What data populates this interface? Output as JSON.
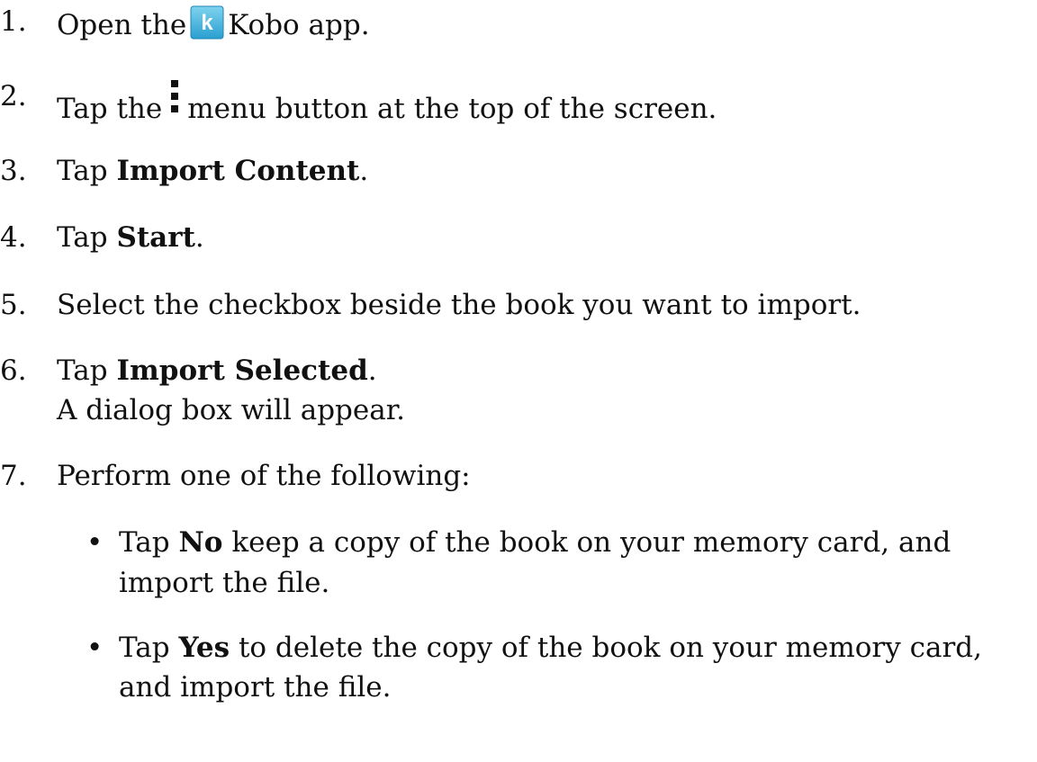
{
  "steps": [
    {
      "number": "1.",
      "before": "Open the",
      "icon": "kobo-app-icon",
      "icon_letter": "k",
      "after": "Kobo app."
    },
    {
      "number": "2.",
      "before": "Tap the",
      "icon": "vertical-ellipsis-menu-icon",
      "after": "menu button at the top of the screen."
    },
    {
      "number": "3.",
      "before": "Tap",
      "bold": "Import Content",
      "after": "."
    },
    {
      "number": "4.",
      "before": "Tap",
      "bold": "Start",
      "after": "."
    },
    {
      "number": "5.",
      "text": "Select the checkbox beside the book you want to import."
    },
    {
      "number": "6.",
      "before": "Tap",
      "bold": "Import Selected",
      "after": ".",
      "note": "A dialog box will appear."
    },
    {
      "number": "7.",
      "text": "Perform one of the following:"
    }
  ],
  "options": [
    {
      "bullet": "•",
      "before": "Tap",
      "bold": "No",
      "line1_after": "keep a copy of the book on your memory card, and",
      "line2": "import the file."
    },
    {
      "bullet": "•",
      "before": "Tap",
      "bold": "Yes",
      "line1_after": "to delete the copy of the book on your memory card,",
      "line2": "and import the file."
    }
  ],
  "colors": {
    "text": "#111111",
    "kobo_icon_bg_light": "#5bc2e7",
    "kobo_icon_bg_dark": "#2a9fd0",
    "kobo_icon_letter": "#ffffff"
  }
}
